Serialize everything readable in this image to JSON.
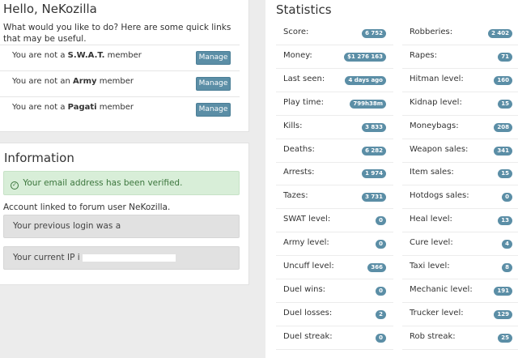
{
  "welcome": {
    "greeting": "Hello, NeKozilla",
    "intro": "What would you like to do? Here are some quick links that may be useful.",
    "memberships": [
      {
        "prefix": "You are not a ",
        "group": "S.W.A.T.",
        "suffix": " member",
        "button": "Manage"
      },
      {
        "prefix": "You are not an ",
        "group": "Army",
        "suffix": " member",
        "button": "Manage"
      },
      {
        "prefix": "You are not a ",
        "group": "Pagati",
        "suffix": " member",
        "button": "Manage"
      }
    ]
  },
  "information": {
    "title": "Information",
    "verified": "Your email address has been verified.",
    "linked": "Account linked to forum user NeKozilla.",
    "previous_login": "Your previous login was a",
    "current_ip": "Your current IP i"
  },
  "statistics": {
    "title": "Statistics",
    "left": [
      {
        "label": "Score:",
        "value": "6 752"
      },
      {
        "label": "Money:",
        "value": "$1 276 163"
      },
      {
        "label": "Last seen:",
        "value": "4 days ago"
      },
      {
        "label": "Play time:",
        "value": "799h38m"
      },
      {
        "label": "Kills:",
        "value": "3 833"
      },
      {
        "label": "Deaths:",
        "value": "6 282"
      },
      {
        "label": "Arrests:",
        "value": "1 974"
      },
      {
        "label": "Tazes:",
        "value": "3 731"
      },
      {
        "label": "SWAT level:",
        "value": "0"
      },
      {
        "label": "Army level:",
        "value": "0"
      },
      {
        "label": "Uncuff level:",
        "value": "366"
      },
      {
        "label": "Duel wins:",
        "value": "0"
      },
      {
        "label": "Duel losses:",
        "value": "2"
      },
      {
        "label": "Duel streak:",
        "value": "0"
      }
    ],
    "right": [
      {
        "label": "Robberies:",
        "value": "2 402"
      },
      {
        "label": "Rapes:",
        "value": "71"
      },
      {
        "label": "Hitman level:",
        "value": "160"
      },
      {
        "label": "Kidnap level:",
        "value": "15"
      },
      {
        "label": "Moneybags:",
        "value": "208"
      },
      {
        "label": "Weapon sales:",
        "value": "341"
      },
      {
        "label": "Item sales:",
        "value": "15"
      },
      {
        "label": "Hotdogs sales:",
        "value": "0"
      },
      {
        "label": "Heal level:",
        "value": "13"
      },
      {
        "label": "Cure level:",
        "value": "4"
      },
      {
        "label": "Taxi level:",
        "value": "8"
      },
      {
        "label": "Mechanic level:",
        "value": "191"
      },
      {
        "label": "Trucker level:",
        "value": "129"
      },
      {
        "label": "Rob streak:",
        "value": "25"
      }
    ]
  }
}
